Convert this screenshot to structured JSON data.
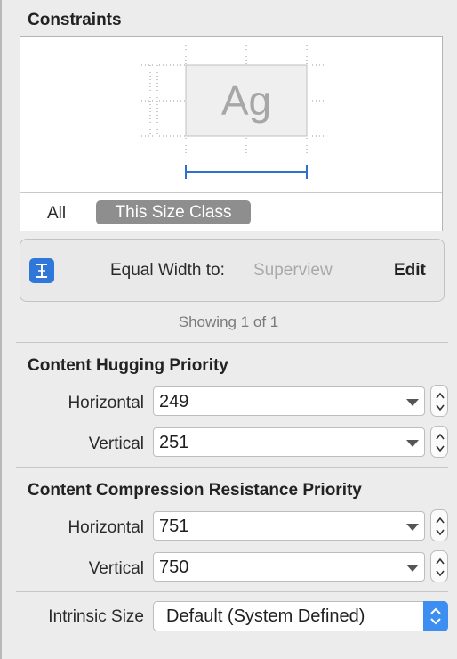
{
  "constraints": {
    "title": "Constraints",
    "preview_text": "Ag",
    "scope_all": "All",
    "scope_size_class": "This Size Class",
    "row": {
      "label": "Equal Width to:",
      "target": "Superview",
      "edit": "Edit",
      "icon": "constraint-icon"
    },
    "showing": "Showing 1 of 1"
  },
  "hugging": {
    "title": "Content Hugging Priority",
    "horizontal_label": "Horizontal",
    "horizontal_value": "249",
    "vertical_label": "Vertical",
    "vertical_value": "251"
  },
  "compression": {
    "title": "Content Compression Resistance Priority",
    "horizontal_label": "Horizontal",
    "horizontal_value": "751",
    "vertical_label": "Vertical",
    "vertical_value": "750"
  },
  "intrinsic": {
    "label": "Intrinsic Size",
    "value": "Default (System Defined)"
  },
  "colors": {
    "accent": "#3d8ef1",
    "constraint_line": "#2f6fce",
    "background": "#ececec"
  }
}
